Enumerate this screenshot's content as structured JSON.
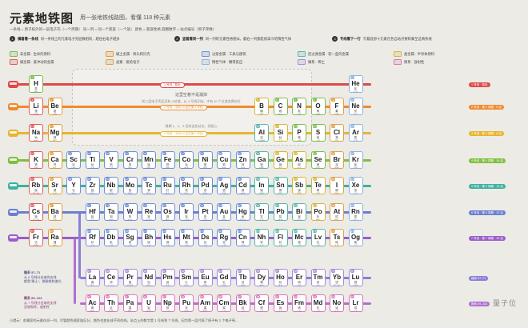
{
  "header": {
    "title": "元素地铁图",
    "subtitle": "用一张地铁线路图，看懂 118 种元素",
    "legend_line": "一条线 = 原子核外的一层电子壳（一个周期）   同一列 = 同一个家族（一个族）   颜色 = 家族性格   圆圈数字 = 站点编号（原子序数）"
  },
  "steps": [
    {
      "num": "1",
      "head": "横着看一条线",
      "text": "同一条线上的元素电子壳层数相同，越往右电子越多"
    },
    {
      "num": "2",
      "head": "竖着看同一列",
      "text": "同一列的元素性格相似，最右一列都是很高冷的惰性气体"
    },
    {
      "num": "3",
      "head": "专线看下一行",
      "text": "写着底部十元素在各自站点要转乘至这两条线"
    }
  ],
  "categories": [
    {
      "label": "非金属 · 生命的原料",
      "color": "#7dbb4f"
    },
    {
      "label": "碱土金属 · 骨头和贝壳",
      "color": "#e39a3a"
    },
    {
      "label": "过渡金属 · 工具与建筑",
      "color": "#6f8fd8"
    },
    {
      "label": "后过渡金属 · 软一些的金属",
      "color": "#5db5a8"
    },
    {
      "label": "类金属 · 半导体原料",
      "color": "#d4b73a"
    },
    {
      "label": "碱金属 · 爱冲动的金属",
      "color": "#e05a5a"
    },
    {
      "label": "卤素 · 爱抢电子",
      "color": "#e0a04a"
    },
    {
      "label": "惰性气体 · 懒得反应",
      "color": "#8bb3e0"
    },
    {
      "label": "镧系 · 稀土",
      "color": "#a98ad8"
    },
    {
      "label": "锕系 · 放射性",
      "color": "#d879b5"
    }
  ],
  "lines": [
    {
      "label": "1 号线 · 氢氦",
      "color": "#e04848"
    },
    {
      "label": "2 号线 · 第 2 周期 · 8 站",
      "color": "#f08a2e"
    },
    {
      "label": "3 号线 · 第 3 周期 · 8 站",
      "color": "#e7b52e"
    },
    {
      "label": "4 号线 · 第 4 周期 · 18 站",
      "color": "#7fbf3f"
    },
    {
      "label": "5 号线 · 第 5 周期 · 18 站",
      "color": "#3fb0a0"
    },
    {
      "label": "6 号线 · 第 6 周期 · 32 站",
      "color": "#6a7fd0"
    },
    {
      "label": "7 号线 · 第 7 周期 · 32 站",
      "color": "#9a5ec8"
    }
  ],
  "period_pills": [
    "1 号线 · 氢氦",
    "2 号线 · 中间 10 站在第 4 号线",
    "3 号线 · 中间 10 站在第 4 号线"
  ],
  "gap": {
    "title": "这里空着不是漏掉",
    "text1": "前三层电子壳还没有 d 轨道，从 4 号线开始，才有 10 个过渡金属站位",
    "text2": "周期 1、2、3 没有这些站点，别担心"
  },
  "series_notes": {
    "la_title": "镧系 57–71",
    "la_text1": "从 6 号线分出来的支线",
    "la_text2": "都是“稀土”，做磁铁和激光",
    "ac_title": "锕系 89–103",
    "ac_text1": "从 7 号线分出来的支线",
    "ac_text2": "含铀和钚，放射性"
  },
  "elements": [
    {
      "z": "1",
      "s": "H",
      "n": "氢",
      "c": "燃料",
      "p": 1,
      "g": 1,
      "t": "nonmetal"
    },
    {
      "z": "2",
      "s": "He",
      "n": "氦",
      "c": "气球",
      "p": 1,
      "g": 18,
      "t": "noble"
    },
    {
      "z": "3",
      "s": "Li",
      "n": "锂",
      "c": "电池",
      "p": 2,
      "g": 1,
      "t": "alkali"
    },
    {
      "z": "4",
      "s": "Be",
      "n": "铍",
      "c": "合金",
      "p": 2,
      "g": 2,
      "t": "alkaline"
    },
    {
      "z": "5",
      "s": "B",
      "n": "硼",
      "c": "玻璃",
      "p": 2,
      "g": 13,
      "t": "metalloid"
    },
    {
      "z": "6",
      "s": "C",
      "n": "碳",
      "c": "生命",
      "p": 2,
      "g": 14,
      "t": "nonmetal"
    },
    {
      "z": "7",
      "s": "N",
      "n": "氮",
      "c": "空气",
      "p": 2,
      "g": 15,
      "t": "nonmetal"
    },
    {
      "z": "8",
      "s": "O",
      "n": "氧",
      "c": "呼吸",
      "p": 2,
      "g": 16,
      "t": "nonmetal"
    },
    {
      "z": "9",
      "s": "F",
      "n": "氟",
      "c": "牙膏",
      "p": 2,
      "g": 17,
      "t": "halogen"
    },
    {
      "z": "10",
      "s": "Ne",
      "n": "氖",
      "c": "霓虹",
      "p": 2,
      "g": 18,
      "t": "noble"
    },
    {
      "z": "11",
      "s": "Na",
      "n": "钠",
      "c": "食盐",
      "p": 3,
      "g": 1,
      "t": "alkali"
    },
    {
      "z": "12",
      "s": "Mg",
      "n": "镁",
      "c": "烟花",
      "p": 3,
      "g": 2,
      "t": "alkaline"
    },
    {
      "z": "13",
      "s": "Al",
      "n": "铝",
      "c": "易拉罐",
      "p": 3,
      "g": 13,
      "t": "post"
    },
    {
      "z": "14",
      "s": "Si",
      "n": "硅",
      "c": "芯片",
      "p": 3,
      "g": 14,
      "t": "metalloid"
    },
    {
      "z": "15",
      "s": "P",
      "n": "磷",
      "c": "火柴",
      "p": 3,
      "g": 15,
      "t": "nonmetal"
    },
    {
      "z": "16",
      "s": "S",
      "n": "硫",
      "c": "火药",
      "p": 3,
      "g": 16,
      "t": "nonmetal"
    },
    {
      "z": "17",
      "s": "Cl",
      "n": "氯",
      "c": "消毒",
      "p": 3,
      "g": 17,
      "t": "halogen"
    },
    {
      "z": "18",
      "s": "Ar",
      "n": "氩",
      "c": "灯泡",
      "p": 3,
      "g": 18,
      "t": "noble"
    },
    {
      "z": "19",
      "s": "K",
      "n": "钾",
      "c": "香蕉",
      "p": 4,
      "g": 1,
      "t": "alkali"
    },
    {
      "z": "20",
      "s": "Ca",
      "n": "钙",
      "c": "骨头",
      "p": 4,
      "g": 2,
      "t": "alkaline"
    },
    {
      "z": "21",
      "s": "Sc",
      "n": "钪",
      "c": "球拍",
      "p": 4,
      "g": 3,
      "t": "transition"
    },
    {
      "z": "22",
      "s": "Ti",
      "n": "钛",
      "c": "飞机",
      "p": 4,
      "g": 4,
      "t": "transition"
    },
    {
      "z": "23",
      "s": "V",
      "n": "钒",
      "c": "工具",
      "p": 4,
      "g": 5,
      "t": "transition"
    },
    {
      "z": "24",
      "s": "Cr",
      "n": "铬",
      "c": "镀层",
      "p": 4,
      "g": 6,
      "t": "transition"
    },
    {
      "z": "25",
      "s": "Mn",
      "n": "锰",
      "c": "钢铁",
      "p": 4,
      "g": 7,
      "t": "transition"
    },
    {
      "z": "26",
      "s": "Fe",
      "n": "铁",
      "c": "钢筋",
      "p": 4,
      "g": 8,
      "t": "transition"
    },
    {
      "z": "27",
      "s": "Co",
      "n": "钴",
      "c": "电池",
      "p": 4,
      "g": 9,
      "t": "transition"
    },
    {
      "z": "28",
      "s": "Ni",
      "n": "镍",
      "c": "硬币",
      "p": 4,
      "g": 10,
      "t": "transition"
    },
    {
      "z": "29",
      "s": "Cu",
      "n": "铜",
      "c": "电线",
      "p": 4,
      "g": 11,
      "t": "transition"
    },
    {
      "z": "30",
      "s": "Zn",
      "n": "锌",
      "c": "防锈",
      "p": 4,
      "g": 12,
      "t": "transition"
    },
    {
      "z": "31",
      "s": "Ga",
      "n": "镓",
      "c": "LED",
      "p": 4,
      "g": 13,
      "t": "post"
    },
    {
      "z": "32",
      "s": "Ge",
      "n": "锗",
      "c": "光纤",
      "p": 4,
      "g": 14,
      "t": "metalloid"
    },
    {
      "z": "33",
      "s": "As",
      "n": "砷",
      "c": "毒药",
      "p": 4,
      "g": 15,
      "t": "metalloid"
    },
    {
      "z": "34",
      "s": "Se",
      "n": "硒",
      "c": "营养",
      "p": 4,
      "g": 16,
      "t": "nonmetal"
    },
    {
      "z": "35",
      "s": "Br",
      "n": "溴",
      "c": "阻燃",
      "p": 4,
      "g": 17,
      "t": "halogen"
    },
    {
      "z": "36",
      "s": "Kr",
      "n": "氪",
      "c": "闪光",
      "p": 4,
      "g": 18,
      "t": "noble"
    },
    {
      "z": "37",
      "s": "Rb",
      "n": "铷",
      "c": "原子钟",
      "p": 5,
      "g": 1,
      "t": "alkali"
    },
    {
      "z": "38",
      "s": "Sr",
      "n": "锶",
      "c": "红焰",
      "p": 5,
      "g": 2,
      "t": "alkaline"
    },
    {
      "z": "39",
      "s": "Y",
      "n": "钇",
      "c": "激光",
      "p": 5,
      "g": 3,
      "t": "transition"
    },
    {
      "z": "40",
      "s": "Zr",
      "n": "锆",
      "c": "核电",
      "p": 5,
      "g": 4,
      "t": "transition"
    },
    {
      "z": "41",
      "s": "Nb",
      "n": "铌",
      "c": "磁体",
      "p": 5,
      "g": 5,
      "t": "transition"
    },
    {
      "z": "42",
      "s": "Mo",
      "n": "钼",
      "c": "钢材",
      "p": 5,
      "g": 6,
      "t": "transition"
    },
    {
      "z": "43",
      "s": "Tc",
      "n": "锝",
      "c": "医疗",
      "p": 5,
      "g": 7,
      "t": "transition"
    },
    {
      "z": "44",
      "s": "Ru",
      "n": "钌",
      "c": "触点",
      "p": 5,
      "g": 8,
      "t": "transition"
    },
    {
      "z": "45",
      "s": "Rh",
      "n": "铑",
      "c": "尾气",
      "p": 5,
      "g": 9,
      "t": "transition"
    },
    {
      "z": "46",
      "s": "Pd",
      "n": "钯",
      "c": "催化",
      "p": 5,
      "g": 10,
      "t": "transition"
    },
    {
      "z": "47",
      "s": "Ag",
      "n": "银",
      "c": "首饰",
      "p": 5,
      "g": 11,
      "t": "transition"
    },
    {
      "z": "48",
      "s": "Cd",
      "n": "镉",
      "c": "电池",
      "p": 5,
      "g": 12,
      "t": "transition"
    },
    {
      "z": "49",
      "s": "In",
      "n": "铟",
      "c": "屏幕",
      "p": 5,
      "g": 13,
      "t": "post"
    },
    {
      "z": "50",
      "s": "Sn",
      "n": "锡",
      "c": "焊锡",
      "p": 5,
      "g": 14,
      "t": "post"
    },
    {
      "z": "51",
      "s": "Sb",
      "n": "锑",
      "c": "阻燃",
      "p": 5,
      "g": 15,
      "t": "metalloid"
    },
    {
      "z": "52",
      "s": "Te",
      "n": "碲",
      "c": "光盘",
      "p": 5,
      "g": 16,
      "t": "metalloid"
    },
    {
      "z": "53",
      "s": "I",
      "n": "碘",
      "c": "碘盐",
      "p": 5,
      "g": 17,
      "t": "halogen"
    },
    {
      "z": "54",
      "s": "Xe",
      "n": "氙",
      "c": "车灯",
      "p": 5,
      "g": 18,
      "t": "noble"
    },
    {
      "z": "55",
      "s": "Cs",
      "n": "铯",
      "c": "原子钟",
      "p": 6,
      "g": 1,
      "t": "alkali"
    },
    {
      "z": "56",
      "s": "Ba",
      "n": "钡",
      "c": "造影",
      "p": 6,
      "g": 2,
      "t": "alkaline"
    },
    {
      "z": "72",
      "s": "Hf",
      "n": "铪",
      "c": "芯片",
      "p": 6,
      "g": 4,
      "t": "transition"
    },
    {
      "z": "73",
      "s": "Ta",
      "n": "钽",
      "c": "电容",
      "p": 6,
      "g": 5,
      "t": "transition"
    },
    {
      "z": "74",
      "s": "W",
      "n": "钨",
      "c": "灯丝",
      "p": 6,
      "g": 6,
      "t": "transition"
    },
    {
      "z": "75",
      "s": "Re",
      "n": "铼",
      "c": "发动机",
      "p": 6,
      "g": 7,
      "t": "transition"
    },
    {
      "z": "76",
      "s": "Os",
      "n": "锇",
      "c": "笔尖",
      "p": 6,
      "g": 8,
      "t": "transition"
    },
    {
      "z": "77",
      "s": "Ir",
      "n": "铱",
      "c": "火花塞",
      "p": 6,
      "g": 9,
      "t": "transition"
    },
    {
      "z": "78",
      "s": "Pt",
      "n": "铂",
      "c": "首饰",
      "p": 6,
      "g": 10,
      "t": "transition"
    },
    {
      "z": "79",
      "s": "Au",
      "n": "金",
      "c": "金条",
      "p": 6,
      "g": 11,
      "t": "transition"
    },
    {
      "z": "80",
      "s": "Hg",
      "n": "汞",
      "c": "温度计",
      "p": 6,
      "g": 12,
      "t": "transition"
    },
    {
      "z": "81",
      "s": "Tl",
      "n": "铊",
      "c": "有毒",
      "p": 6,
      "g": 13,
      "t": "post"
    },
    {
      "z": "82",
      "s": "Pb",
      "n": "铅",
      "c": "电池",
      "p": 6,
      "g": 14,
      "t": "post"
    },
    {
      "z": "83",
      "s": "Bi",
      "n": "铋",
      "c": "胃药",
      "p": 6,
      "g": 15,
      "t": "post"
    },
    {
      "z": "84",
      "s": "Po",
      "n": "钋",
      "c": "放射",
      "p": 6,
      "g": 16,
      "t": "metalloid"
    },
    {
      "z": "85",
      "s": "At",
      "n": "砹",
      "c": "稀有",
      "p": 6,
      "g": 17,
      "t": "halogen"
    },
    {
      "z": "86",
      "s": "Rn",
      "n": "氡",
      "c": "地下",
      "p": 6,
      "g": 18,
      "t": "noble"
    },
    {
      "z": "87",
      "s": "Fr",
      "n": "钫",
      "c": "极稀",
      "p": 7,
      "g": 1,
      "t": "alkali"
    },
    {
      "z": "88",
      "s": "Ra",
      "n": "镭",
      "c": "放射",
      "p": 7,
      "g": 2,
      "t": "alkaline"
    },
    {
      "z": "104",
      "s": "Rf",
      "n": "𬬻",
      "c": "人造",
      "p": 7,
      "g": 4,
      "t": "transition"
    },
    {
      "z": "105",
      "s": "Db",
      "n": "𬭊",
      "c": "人造",
      "p": 7,
      "g": 5,
      "t": "transition"
    },
    {
      "z": "106",
      "s": "Sg",
      "n": "𬭳",
      "c": "人造",
      "p": 7,
      "g": 6,
      "t": "transition"
    },
    {
      "z": "107",
      "s": "Bh",
      "n": "𬭛",
      "c": "人造",
      "p": 7,
      "g": 7,
      "t": "transition"
    },
    {
      "z": "108",
      "s": "Hs",
      "n": "𬭶",
      "c": "人造",
      "p": 7,
      "g": 8,
      "t": "transition"
    },
    {
      "z": "109",
      "s": "Mt",
      "n": "鿏",
      "c": "人造",
      "p": 7,
      "g": 9,
      "t": "transition"
    },
    {
      "z": "110",
      "s": "Ds",
      "n": "𫟼",
      "c": "人造",
      "p": 7,
      "g": 10,
      "t": "transition"
    },
    {
      "z": "111",
      "s": "Rg",
      "n": "𬬭",
      "c": "人造",
      "p": 7,
      "g": 11,
      "t": "transition"
    },
    {
      "z": "112",
      "s": "Cn",
      "n": "鿔",
      "c": "人造",
      "p": 7,
      "g": 12,
      "t": "transition"
    },
    {
      "z": "113",
      "s": "Nh",
      "n": "鿭",
      "c": "人造",
      "p": 7,
      "g": 13,
      "t": "post"
    },
    {
      "z": "114",
      "s": "Fl",
      "n": "𫓧",
      "c": "人造",
      "p": 7,
      "g": 14,
      "t": "post"
    },
    {
      "z": "115",
      "s": "Mc",
      "n": "镆",
      "c": "人造",
      "p": 7,
      "g": 15,
      "t": "post"
    },
    {
      "z": "116",
      "s": "Lv",
      "n": "𫟷",
      "c": "人造",
      "p": 7,
      "g": 16,
      "t": "post"
    },
    {
      "z": "117",
      "s": "Ts",
      "n": "鿬",
      "c": "人造",
      "p": 7,
      "g": 17,
      "t": "halogen"
    },
    {
      "z": "118",
      "s": "Og",
      "n": "鿫",
      "c": "人造",
      "p": 7,
      "g": 18,
      "t": "noble"
    },
    {
      "z": "57",
      "s": "La",
      "n": "镧",
      "c": "镜头",
      "p": 8,
      "g": 4,
      "t": "lanth"
    },
    {
      "z": "58",
      "s": "Ce",
      "n": "铈",
      "c": "打火石",
      "p": 8,
      "g": 5,
      "t": "lanth"
    },
    {
      "z": "59",
      "s": "Pr",
      "n": "镨",
      "c": "护目镜",
      "p": 8,
      "g": 6,
      "t": "lanth"
    },
    {
      "z": "60",
      "s": "Nd",
      "n": "钕",
      "c": "磁铁",
      "p": 8,
      "g": 7,
      "t": "lanth"
    },
    {
      "z": "61",
      "s": "Pm",
      "n": "钷",
      "c": "夜光",
      "p": 8,
      "g": 8,
      "t": "lanth"
    },
    {
      "z": "62",
      "s": "Sm",
      "n": "钐",
      "c": "磁铁",
      "p": 8,
      "g": 9,
      "t": "lanth"
    },
    {
      "z": "63",
      "s": "Eu",
      "n": "铕",
      "c": "钞票",
      "p": 8,
      "g": 10,
      "t": "lanth"
    },
    {
      "z": "64",
      "s": "Gd",
      "n": "钆",
      "c": "核磁",
      "p": 8,
      "g": 11,
      "t": "lanth"
    },
    {
      "z": "65",
      "s": "Tb",
      "n": "铽",
      "c": "屏幕",
      "p": 8,
      "g": 12,
      "t": "lanth"
    },
    {
      "z": "66",
      "s": "Dy",
      "n": "镝",
      "c": "电机",
      "p": 8,
      "g": 13,
      "t": "lanth"
    },
    {
      "z": "67",
      "s": "Ho",
      "n": "钬",
      "c": "激光",
      "p": 8,
      "g": 14,
      "t": "lanth"
    },
    {
      "z": "68",
      "s": "Er",
      "n": "铒",
      "c": "光纤",
      "p": 8,
      "g": 15,
      "t": "lanth"
    },
    {
      "z": "69",
      "s": "Tm",
      "n": "铥",
      "c": "X光",
      "p": 8,
      "g": 16,
      "t": "lanth"
    },
    {
      "z": "70",
      "s": "Yb",
      "n": "镱",
      "c": "原子钟",
      "p": 8,
      "g": 17,
      "t": "lanth"
    },
    {
      "z": "71",
      "s": "Lu",
      "n": "镥",
      "c": "探测",
      "p": 8,
      "g": 18,
      "t": "lanth"
    },
    {
      "z": "89",
      "s": "Ac",
      "n": "锕",
      "c": "放射",
      "p": 9,
      "g": 4,
      "t": "actin"
    },
    {
      "z": "90",
      "s": "Th",
      "n": "钍",
      "c": "核能",
      "p": 9,
      "g": 5,
      "t": "actin"
    },
    {
      "z": "91",
      "s": "Pa",
      "n": "镤",
      "c": "稀有",
      "p": 9,
      "g": 6,
      "t": "actin"
    },
    {
      "z": "92",
      "s": "U",
      "n": "铀",
      "c": "核电",
      "p": 9,
      "g": 7,
      "t": "actin"
    },
    {
      "z": "93",
      "s": "Np",
      "n": "镎",
      "c": "人造",
      "p": 9,
      "g": 8,
      "t": "actin"
    },
    {
      "z": "94",
      "s": "Pu",
      "n": "钚",
      "c": "核能",
      "p": 9,
      "g": 9,
      "t": "actin"
    },
    {
      "z": "95",
      "s": "Am",
      "n": "镅",
      "c": "烟感",
      "p": 9,
      "g": 10,
      "t": "actin"
    },
    {
      "z": "96",
      "s": "Cm",
      "n": "锔",
      "c": "人造",
      "p": 9,
      "g": 11,
      "t": "actin"
    },
    {
      "z": "97",
      "s": "Bk",
      "n": "锫",
      "c": "人造",
      "p": 9,
      "g": 12,
      "t": "actin"
    },
    {
      "z": "98",
      "s": "Cf",
      "n": "锎",
      "c": "人造",
      "p": 9,
      "g": 13,
      "t": "actin"
    },
    {
      "z": "99",
      "s": "Es",
      "n": "锿",
      "c": "人造",
      "p": 9,
      "g": 14,
      "t": "actin"
    },
    {
      "z": "100",
      "s": "Fm",
      "n": "镄",
      "c": "人造",
      "p": 9,
      "g": 15,
      "t": "actin"
    },
    {
      "z": "101",
      "s": "Md",
      "n": "钔",
      "c": "人造",
      "p": 9,
      "g": 16,
      "t": "actin"
    },
    {
      "z": "102",
      "s": "No",
      "n": "锘",
      "c": "人造",
      "p": 9,
      "g": 17,
      "t": "actin"
    },
    {
      "z": "103",
      "s": "Lr",
      "n": "铹",
      "c": "人造",
      "p": 9,
      "g": 18,
      "t": "actin"
    }
  ],
  "type_colors": {
    "nonmetal": "#7dbb4f",
    "alkali": "#e05a5a",
    "alkaline": "#e39a3a",
    "transition": "#6f8fd8",
    "post": "#5db5a8",
    "metalloid": "#d4b73a",
    "halogen": "#e0a04a",
    "noble": "#8bb3e0",
    "lanth": "#a98ad8",
    "actin": "#d879b5"
  },
  "footer": "小提示：各属家的元素在同一列，尽管颜色随家族区分，颜色也变化成不同的线。站点上的数字是 1 号线到 7 号线，因为第一层代表了原子有 1 个电子壳...",
  "watermark": "量子位"
}
